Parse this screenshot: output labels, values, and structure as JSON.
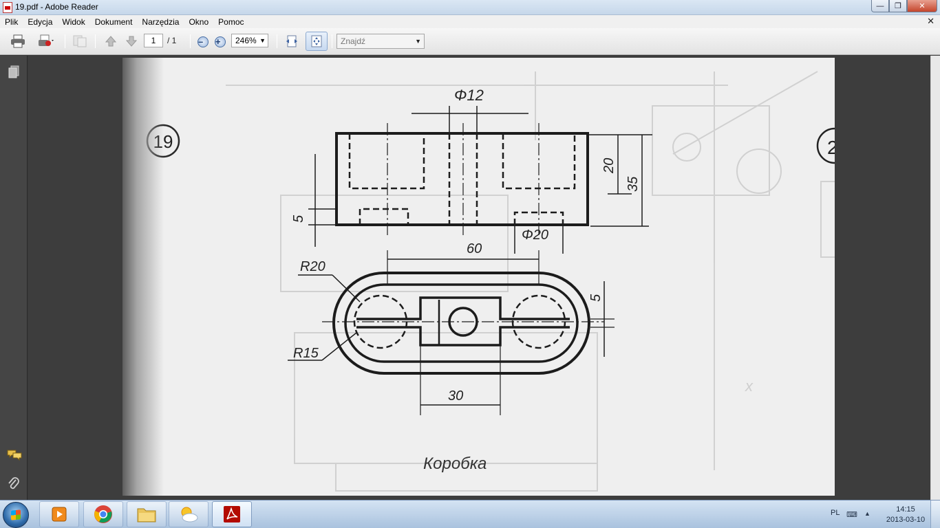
{
  "window": {
    "title": "19.pdf - Adobe Reader"
  },
  "menu": [
    "Plik",
    "Edycja",
    "Widok",
    "Dokument",
    "Narzędzia",
    "Okno",
    "Pomoc"
  ],
  "toolbar": {
    "page_current": "1",
    "page_total": "/ 1",
    "zoom": "246%",
    "find_placeholder": "Znajdź"
  },
  "drawing": {
    "sheet_number_left": "19",
    "sheet_number_right": "2",
    "title": "Коробка",
    "dims": {
      "phi12": "Φ12",
      "d20": "20",
      "d35": "35",
      "d5_left": "5",
      "phi20": "Φ20",
      "d60": "60",
      "r20": "R20",
      "r15": "R15",
      "d5_right": "5",
      "d30": "30"
    }
  },
  "taskbar": {
    "language": "PL",
    "time": "14:15",
    "date": "2013-03-10",
    "apps": [
      "media-player",
      "chrome",
      "explorer",
      "weather",
      "adobe-reader"
    ]
  }
}
